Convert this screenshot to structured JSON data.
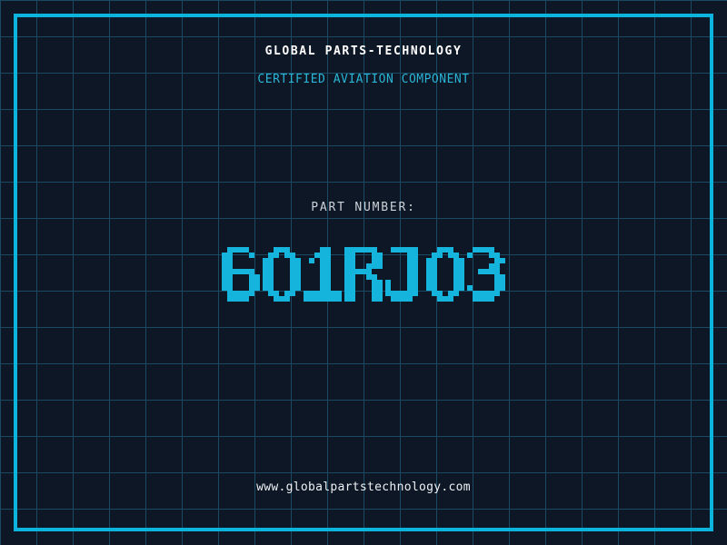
{
  "header": {
    "title": "GLOBAL PARTS-TECHNOLOGY",
    "subtitle": "CERTIFIED AVIATION COMPONENT"
  },
  "part": {
    "label": "PART NUMBER:",
    "number": "601RJ03"
  },
  "footer": {
    "website": "www.globalpartstechnology.com"
  },
  "colors": {
    "background": "#0e1726",
    "grid_line": "#1b4a63",
    "frame_accent": "#0db4dc",
    "subtitle_cyan": "#2ab4d6",
    "part_number_cyan": "#14b4dc",
    "label_gray": "#ccd2d9",
    "text_white": "#ffffff"
  }
}
